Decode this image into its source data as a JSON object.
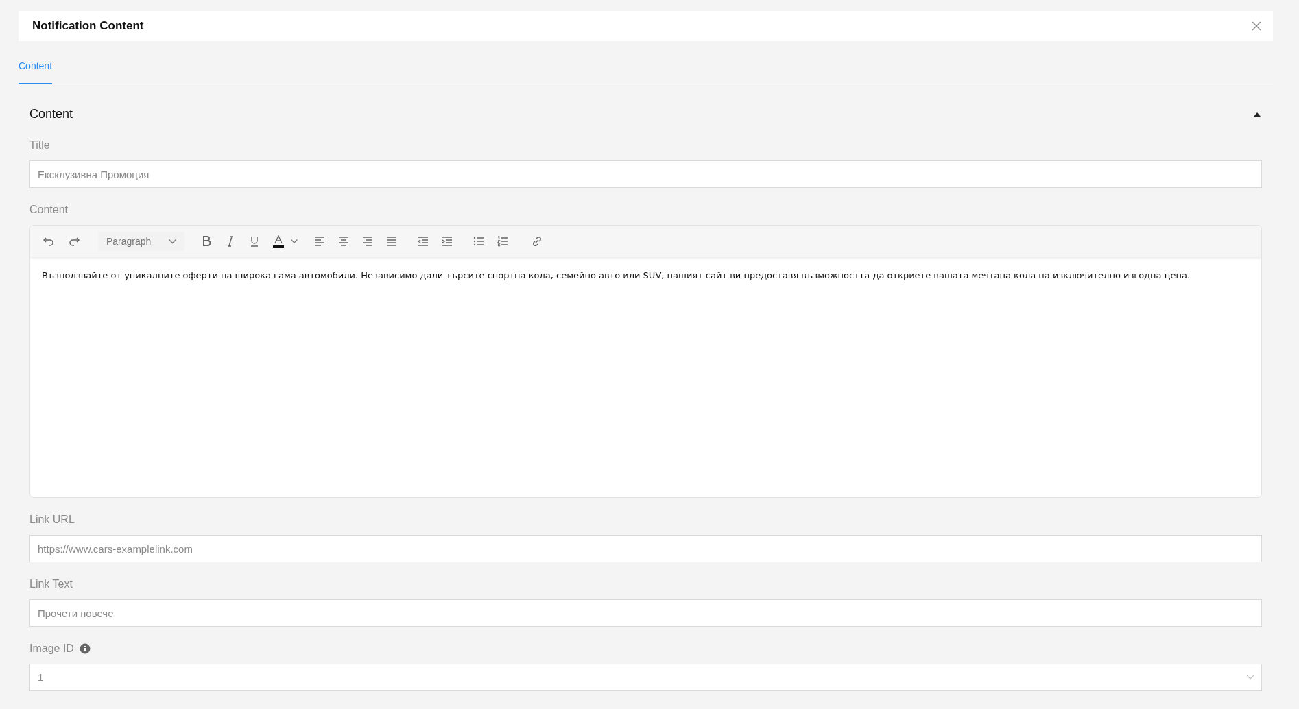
{
  "dialog": {
    "title": "Notification Content"
  },
  "tabs": [
    {
      "label": "Content",
      "selected": true
    }
  ],
  "section": {
    "title": "Content",
    "expanded": true
  },
  "fields": [
    {
      "kind": "text",
      "label": "Title",
      "value": "Ексклузивна Промоция"
    },
    {
      "kind": "editor",
      "label": "Content",
      "block_format": "Paragraph",
      "toolbar": [
        {
          "kind": "undo"
        },
        {
          "kind": "redo"
        },
        {
          "kind": "format"
        },
        {
          "kind": "bold"
        },
        {
          "kind": "italic"
        },
        {
          "kind": "underline"
        },
        {
          "kind": "color"
        },
        {
          "kind": "align-left"
        },
        {
          "kind": "align-center"
        },
        {
          "kind": "align-right"
        },
        {
          "kind": "justify"
        },
        {
          "kind": "outdent"
        },
        {
          "kind": "indent"
        },
        {
          "kind": "bullets"
        },
        {
          "kind": "numbers"
        },
        {
          "kind": "link"
        }
      ],
      "value": "Възползвайте от уникалните оферти на широка гама автомобили. Независимо дали търсите спортна кола, семейно авто или SUV, нашият сайт ви предоставя възможността да откриете вашата мечтана кола на изключително изгодна цена."
    },
    {
      "kind": "text",
      "label": "Link URL",
      "value": "https://www.cars-examplelink.com"
    },
    {
      "kind": "text",
      "label": "Link Text",
      "value": "Прочети повече"
    },
    {
      "kind": "select",
      "label": "Image ID",
      "info": true,
      "value": "1"
    }
  ]
}
